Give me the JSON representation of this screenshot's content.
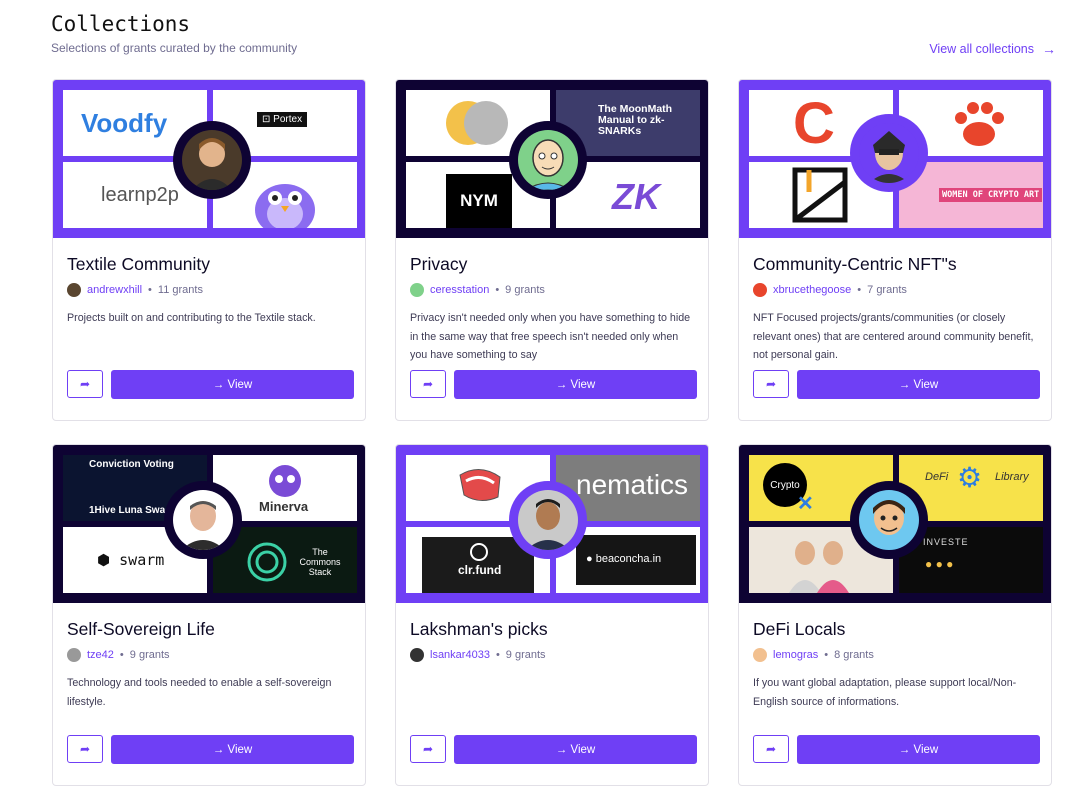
{
  "header": {
    "title": "Collections",
    "subtitle": "Selections of grants curated by the community",
    "view_all": "View all collections",
    "view_all_arrow": "→"
  },
  "colors": {
    "accent": "#6f3ff5",
    "navy": "#0e0333",
    "muted": "#6f6c90"
  },
  "cards": [
    {
      "title": "Textile Community",
      "user": "andrewxhill",
      "grants": "11 grants",
      "description": "Projects built on and contributing to the Textile stack.",
      "view_label": "→ View",
      "tiles": [
        "Voodfy",
        "Portex",
        "learnp2p",
        ""
      ]
    },
    {
      "title": "Privacy",
      "user": "ceresstation",
      "grants": "9 grants",
      "description": "Privacy isn't needed only when you have something to hide in the same way that free speech isn't needed only when you have something to say",
      "view_label": "→ View",
      "tiles": [
        "",
        "The MoonMath Manual to zk-SNARKs",
        "NYM",
        "ZK"
      ]
    },
    {
      "title": "Community-Centric NFT\"s",
      "user": "xbrucethegoose",
      "grants": "7 grants",
      "description": "NFT Focused projects/grants/communities (or closely relevant ones) that are centered around community benefit, not personal gain.",
      "view_label": "→ View",
      "tiles": [
        "C",
        "",
        "",
        "WOMEN OF CRYPTO ART"
      ]
    },
    {
      "title": "Self-Sovereign Life",
      "user": "tze42",
      "grants": "9 grants",
      "description": "Technology and tools needed to enable a self-sovereign lifestyle.",
      "view_label": "→ View",
      "tiles": [
        "Conviction Voting",
        "1Hive Luna Swa",
        "Minerva",
        "swarm",
        "The Commons Stack"
      ]
    },
    {
      "title": "Lakshman's picks",
      "user": "lsankar4033",
      "grants": "9 grants",
      "description": "",
      "view_label": "→ View",
      "tiles": [
        "",
        "nematics",
        "clr.fund",
        "beaconcha.in"
      ]
    },
    {
      "title": "DeFi Locals",
      "user": "lemogras",
      "grants": "8 grants",
      "description": "If you want global adaptation, please support local/Non-English source of informations.",
      "view_label": "→ View",
      "tiles": [
        "Crypto",
        "DeFi",
        "Library",
        "INVESTE"
      ]
    }
  ]
}
